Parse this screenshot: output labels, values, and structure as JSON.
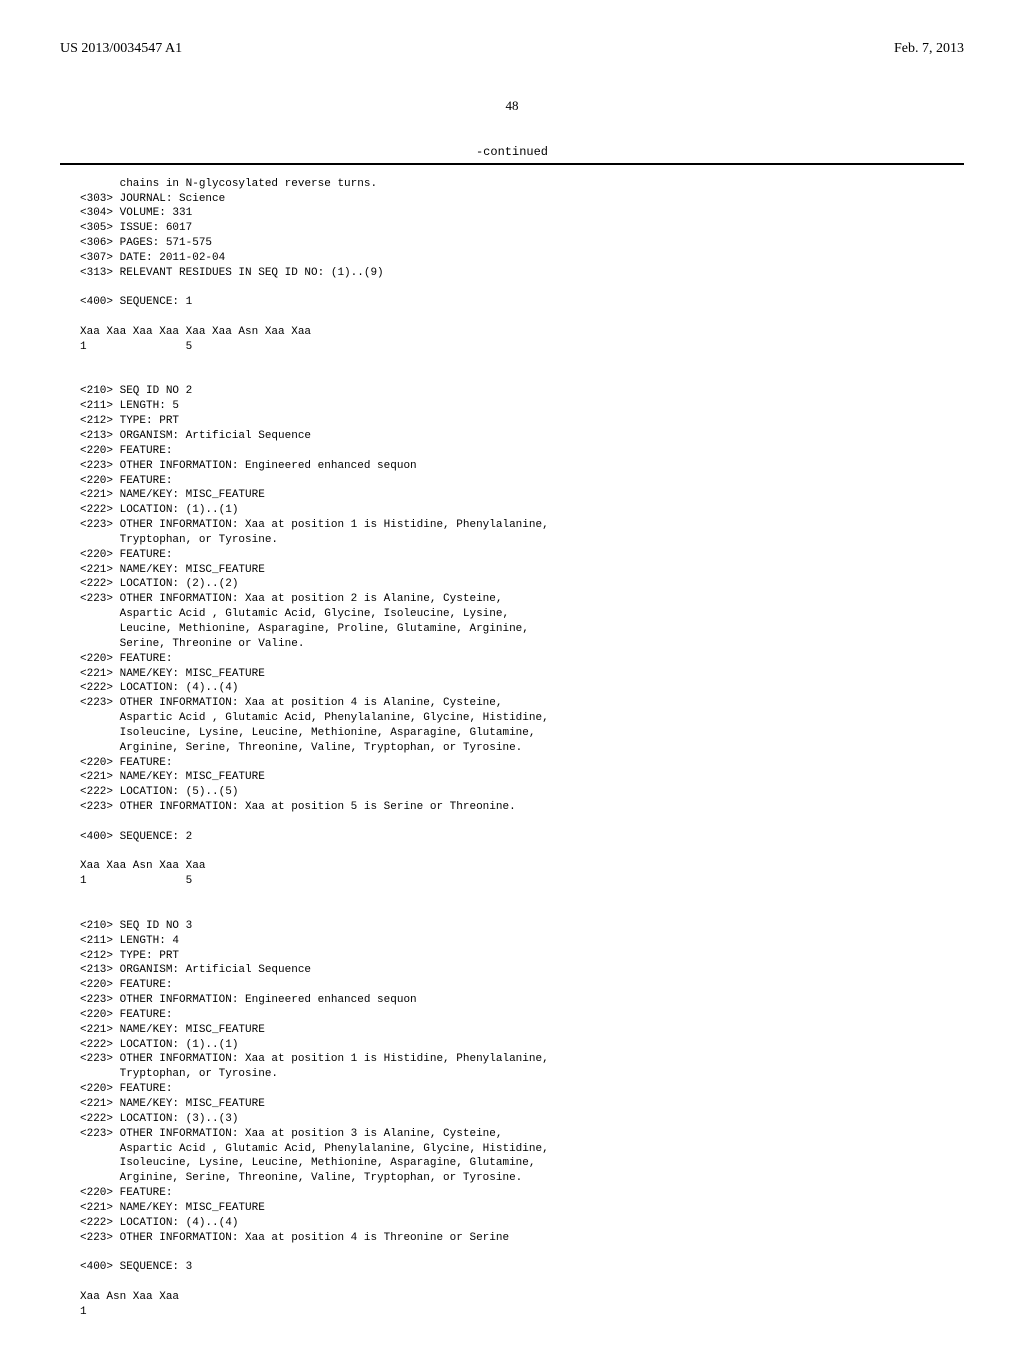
{
  "header": {
    "pub_number": "US 2013/0034547 A1",
    "pub_date": "Feb. 7, 2013"
  },
  "page_number": "48",
  "continued_label": "-continued",
  "sequence_listing": "      chains in N-glycosylated reverse turns.\n<303> JOURNAL: Science\n<304> VOLUME: 331\n<305> ISSUE: 6017\n<306> PAGES: 571-575\n<307> DATE: 2011-02-04\n<313> RELEVANT RESIDUES IN SEQ ID NO: (1)..(9)\n\n<400> SEQUENCE: 1\n\nXaa Xaa Xaa Xaa Xaa Xaa Asn Xaa Xaa\n1               5\n\n\n<210> SEQ ID NO 2\n<211> LENGTH: 5\n<212> TYPE: PRT\n<213> ORGANISM: Artificial Sequence\n<220> FEATURE:\n<223> OTHER INFORMATION: Engineered enhanced sequon\n<220> FEATURE:\n<221> NAME/KEY: MISC_FEATURE\n<222> LOCATION: (1)..(1)\n<223> OTHER INFORMATION: Xaa at position 1 is Histidine, Phenylalanine,\n      Tryptophan, or Tyrosine.\n<220> FEATURE:\n<221> NAME/KEY: MISC_FEATURE\n<222> LOCATION: (2)..(2)\n<223> OTHER INFORMATION: Xaa at position 2 is Alanine, Cysteine,\n      Aspartic Acid , Glutamic Acid, Glycine, Isoleucine, Lysine,\n      Leucine, Methionine, Asparagine, Proline, Glutamine, Arginine,\n      Serine, Threonine or Valine.\n<220> FEATURE:\n<221> NAME/KEY: MISC_FEATURE\n<222> LOCATION: (4)..(4)\n<223> OTHER INFORMATION: Xaa at position 4 is Alanine, Cysteine,\n      Aspartic Acid , Glutamic Acid, Phenylalanine, Glycine, Histidine,\n      Isoleucine, Lysine, Leucine, Methionine, Asparagine, Glutamine,\n      Arginine, Serine, Threonine, Valine, Tryptophan, or Tyrosine.\n<220> FEATURE:\n<221> NAME/KEY: MISC_FEATURE\n<222> LOCATION: (5)..(5)\n<223> OTHER INFORMATION: Xaa at position 5 is Serine or Threonine.\n\n<400> SEQUENCE: 2\n\nXaa Xaa Asn Xaa Xaa\n1               5\n\n\n<210> SEQ ID NO 3\n<211> LENGTH: 4\n<212> TYPE: PRT\n<213> ORGANISM: Artificial Sequence\n<220> FEATURE:\n<223> OTHER INFORMATION: Engineered enhanced sequon\n<220> FEATURE:\n<221> NAME/KEY: MISC_FEATURE\n<222> LOCATION: (1)..(1)\n<223> OTHER INFORMATION: Xaa at position 1 is Histidine, Phenylalanine,\n      Tryptophan, or Tyrosine.\n<220> FEATURE:\n<221> NAME/KEY: MISC_FEATURE\n<222> LOCATION: (3)..(3)\n<223> OTHER INFORMATION: Xaa at position 3 is Alanine, Cysteine,\n      Aspartic Acid , Glutamic Acid, Phenylalanine, Glycine, Histidine,\n      Isoleucine, Lysine, Leucine, Methionine, Asparagine, Glutamine,\n      Arginine, Serine, Threonine, Valine, Tryptophan, or Tyrosine.\n<220> FEATURE:\n<221> NAME/KEY: MISC_FEATURE\n<222> LOCATION: (4)..(4)\n<223> OTHER INFORMATION: Xaa at position 4 is Threonine or Serine\n\n<400> SEQUENCE: 3\n\nXaa Asn Xaa Xaa\n1"
}
